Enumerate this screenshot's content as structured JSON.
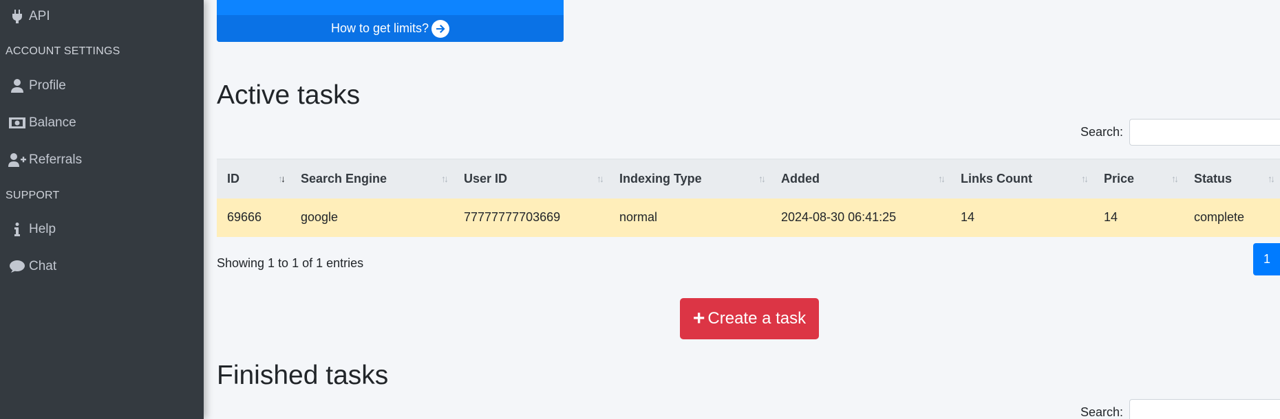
{
  "sidebar": {
    "api_label": "API",
    "account_header": "ACCOUNT SETTINGS",
    "profile_label": "Profile",
    "balance_label": "Balance",
    "referrals_label": "Referrals",
    "support_header": "SUPPORT",
    "help_label": "Help",
    "chat_label": "Chat"
  },
  "limits_card": {
    "link_text": "How to get limits?"
  },
  "active": {
    "title": "Active tasks",
    "search_label": "Search:",
    "columns": [
      "ID",
      "Search Engine",
      "User ID",
      "Indexing Type",
      "Added",
      "Links Count",
      "Price",
      "Status"
    ],
    "rows": [
      [
        "69666",
        "google",
        "77777777703669",
        "normal",
        "2024-08-30 06:41:25",
        "14",
        "14",
        "complete"
      ]
    ],
    "info": "Showing 1 to 1 of 1 entries",
    "current_page": "1"
  },
  "create_button": "Create a task",
  "finished": {
    "title": "Finished tasks",
    "search_label": "Search:"
  },
  "colors": {
    "sidebar_bg": "#343a40",
    "primary": "#007bff",
    "danger": "#dc3545",
    "row_highlight": "#ffeeba"
  }
}
